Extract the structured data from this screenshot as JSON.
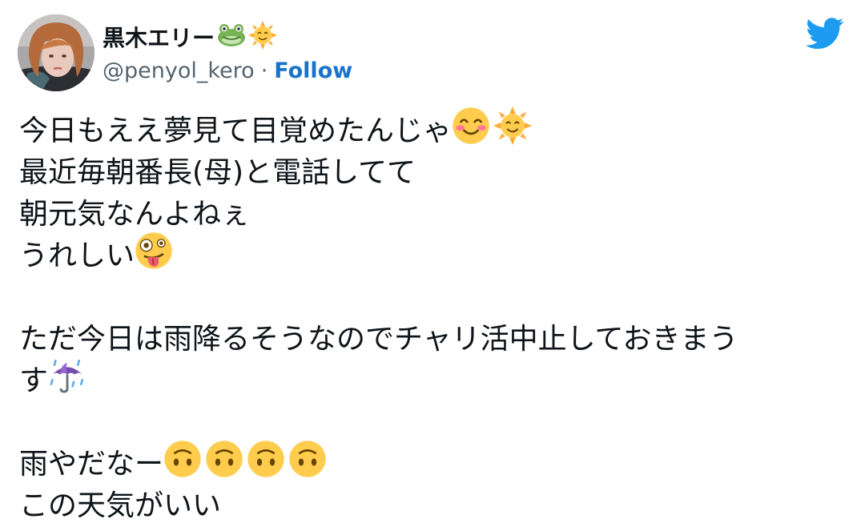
{
  "user": {
    "display_name": "黒木エリー",
    "name_emojis": [
      "frog-face-icon",
      "sun-with-face-icon"
    ],
    "handle": "@penyol_kero",
    "separator": "·",
    "follow_label": "Follow"
  },
  "tweet": {
    "lines": [
      "今日もええ夢見て目覚めたんじゃ",
      "最近毎朝番長(母)と電話してて",
      "朝元気なんよねぇ",
      "うれしい",
      "ただ今日は雨降るそうなのでチャリ活中止しておきまう",
      "す",
      "雨やだなー",
      "この天気がいい"
    ],
    "emojis": {
      "line1": [
        "smiling-face-with-smiling-eyes-icon",
        "sun-with-face-icon"
      ],
      "line4": [
        "zany-face-icon"
      ],
      "line6": [
        "umbrella-with-rain-icon"
      ],
      "line7": [
        "upside-down-face-icon",
        "upside-down-face-icon",
        "upside-down-face-icon",
        "upside-down-face-icon"
      ]
    }
  },
  "colors": {
    "link_blue": "#1b73c9",
    "twitter_blue": "#1d9bf0",
    "secondary_text": "#536471",
    "emoji_yellow": "#ffcc4d"
  }
}
